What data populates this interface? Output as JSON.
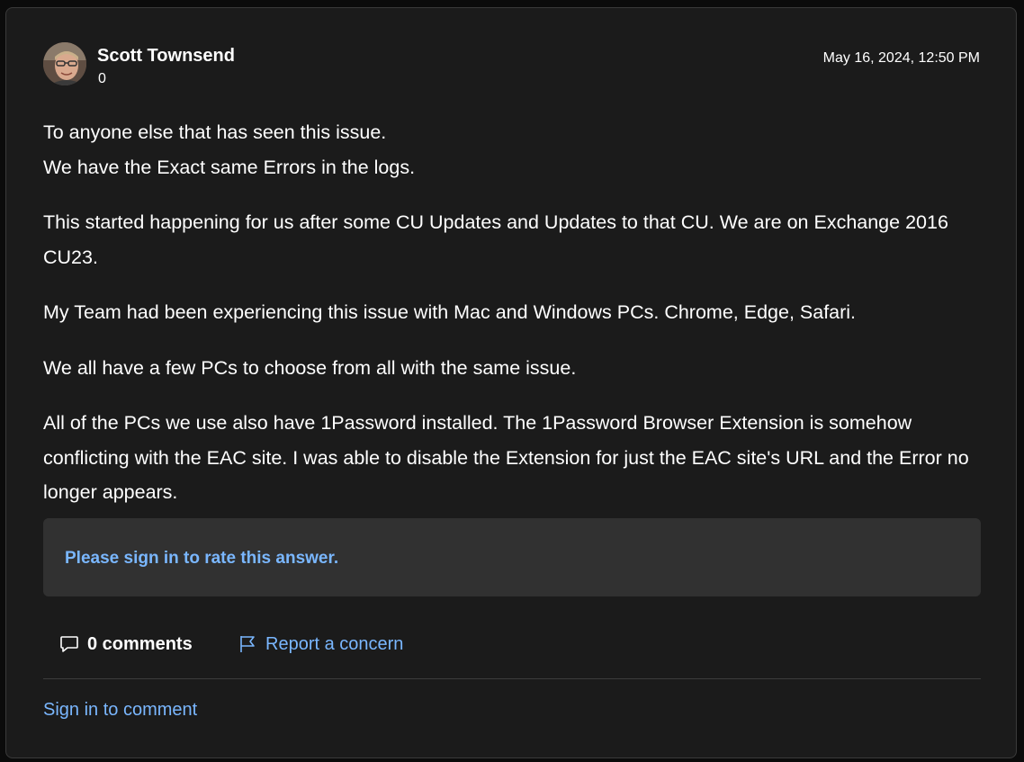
{
  "post": {
    "author": {
      "name": "Scott Townsend",
      "reputation": "0",
      "avatar": "user-photo"
    },
    "date": "May 16, 2024, 12:50 PM",
    "body": {
      "p1_line1": "To anyone else that has seen this issue.",
      "p1_line2": "We have the Exact same Errors in the logs.",
      "p2": "This started happening for us after some CU Updates and Updates to that CU. We are on Exchange 2016 CU23.",
      "p3": "My Team had been experiencing this issue with Mac and Windows PCs. Chrome, Edge, Safari.",
      "p4": "We all have a few PCs to choose from all with the same issue.",
      "p5": "All of the PCs we use also have 1Password installed. The 1Password Browser Extension is somehow conflicting with the EAC site. I was able to disable the Extension for just the EAC site's URL and the Error no longer appears."
    }
  },
  "rating": {
    "sign_in_label": "Please sign in to rate this answer."
  },
  "actions": {
    "comments_label": "0 comments",
    "comments_icon": "comment-icon",
    "report_label": "Report a concern",
    "report_icon": "flag-icon"
  },
  "footer": {
    "sign_in_comment": "Sign in to comment"
  },
  "colors": {
    "background": "#1b1b1b",
    "link": "#7ab7ff",
    "rate_box": "#313131"
  }
}
